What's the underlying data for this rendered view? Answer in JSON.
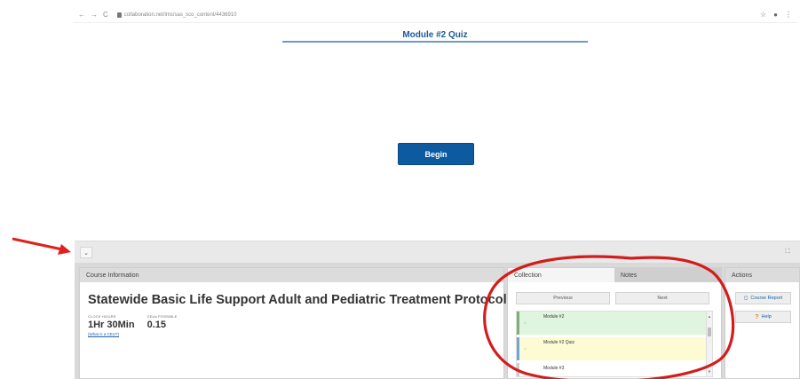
{
  "browser": {
    "url": "collaboration.net/lms/sas_sco_content/4436910",
    "nav": {
      "back": "←",
      "forward": "→",
      "reload": "C"
    },
    "icons": [
      "star-icon",
      "account-icon",
      "menu-icon"
    ]
  },
  "quiz": {
    "title": "Module #2 Quiz",
    "begin_label": "Begin"
  },
  "annotations": {
    "arrow_color": "#e0201c",
    "circle_color": "#d31d1d"
  },
  "bar": {
    "collapse_icon": "chevron-down-icon",
    "expand_icon": "fullscreen-icon"
  },
  "course": {
    "header": "Course Information",
    "title": "Statewide Basic Life Support Adult and Pediatric Treatment Protocols",
    "clock_hours_label": "CLOCK HOURS",
    "clock_hours_value": "1Hr 30Min",
    "ceus_label": "CEUs POSSIBLE",
    "ceus_value": "0.15",
    "ceu_link": "(What is a CEU?)"
  },
  "collection": {
    "tabs": [
      {
        "label": "Collection"
      },
      {
        "label": "Notes"
      }
    ],
    "previous_label": "Previous",
    "next_label": "Next",
    "items": [
      {
        "label": "Module #2",
        "color": "#dff5dd",
        "accent": "#7fb07a"
      },
      {
        "label": "Module #2 Quiz",
        "color": "#fdfbd3",
        "accent": "#6fa7d6"
      },
      {
        "label": "Module #3",
        "color": "#ffffff",
        "accent": "#cccccc"
      }
    ]
  },
  "actions": {
    "header": "Actions",
    "course_report_label": "Course Report",
    "help_label": "Help"
  }
}
